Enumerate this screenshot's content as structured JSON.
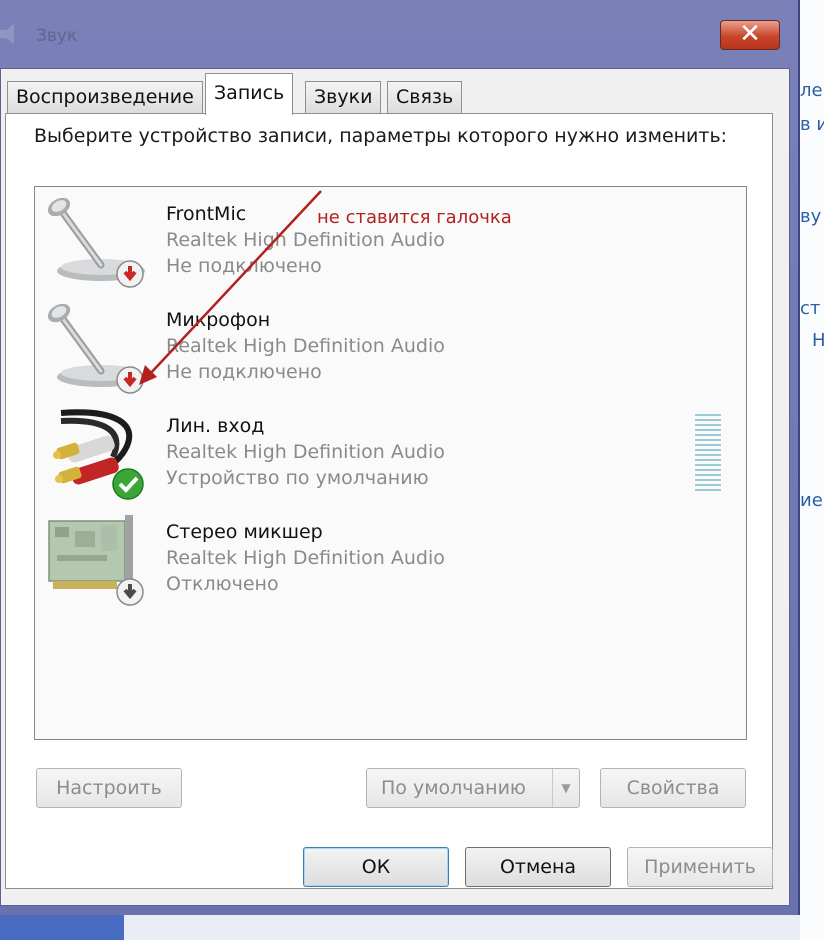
{
  "window": {
    "title": "Звук",
    "close_glyph": "✕"
  },
  "tabs": [
    {
      "label": "Воспроизведение",
      "active": false
    },
    {
      "label": "Запись",
      "active": true
    },
    {
      "label": "Звуки",
      "active": false
    },
    {
      "label": "Связь",
      "active": false
    }
  ],
  "instruction": "Выберите устройство записи, параметры которого нужно изменить:",
  "annotation": "не ставится галочка",
  "devices": [
    {
      "name": "FrontMic",
      "driver": "Realtek High Definition Audio",
      "status": "Не подключено",
      "icon": "microphone-icon",
      "badge": "red-down-arrow"
    },
    {
      "name": "Микрофон",
      "driver": "Realtek High Definition Audio",
      "status": "Не подключено",
      "icon": "microphone-icon",
      "badge": "red-down-arrow"
    },
    {
      "name": "Лин. вход",
      "driver": "Realtek High Definition Audio",
      "status": "Устройство по умолчанию",
      "icon": "rca-cable-icon",
      "badge": "green-check"
    },
    {
      "name": "Стерео микшер",
      "driver": "Realtek High Definition Audio",
      "status": "Отключено",
      "icon": "sound-card-icon",
      "badge": "gray-down-arrow"
    }
  ],
  "buttons": {
    "configure": "Настроить",
    "set_default": "По умолчанию",
    "properties": "Свойства",
    "ok": "ОК",
    "cancel": "Отмена",
    "apply": "Применить"
  },
  "background_window": {
    "fragments": [
      "ле",
      "в и",
      "ву",
      "ст",
      "Н",
      "ие"
    ]
  },
  "colors": {
    "annotation": "#b3201e",
    "frame": "#7a80b8",
    "close_button": "#c9462c"
  }
}
